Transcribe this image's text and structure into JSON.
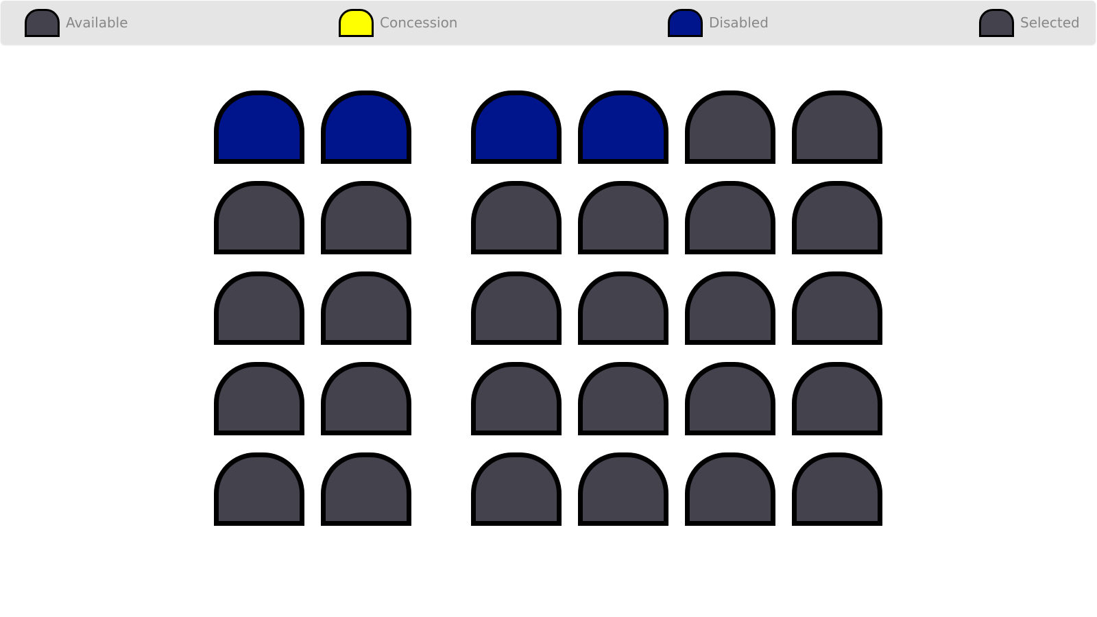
{
  "colors": {
    "available": "#43424d",
    "concession": "#ffff00",
    "disabled": "#00148c",
    "selected": "#43424d"
  },
  "legend": [
    {
      "key": "available",
      "label": "Available"
    },
    {
      "key": "concession",
      "label": "Concession"
    },
    {
      "key": "disabled",
      "label": "Disabled"
    },
    {
      "key": "selected",
      "label": "Selected"
    }
  ],
  "seat_map": {
    "blocks": [
      {
        "name": "left",
        "rows": [
          [
            "disabled",
            "disabled"
          ],
          [
            "available",
            "available"
          ],
          [
            "available",
            "available"
          ],
          [
            "available",
            "available"
          ],
          [
            "available",
            "available"
          ]
        ]
      },
      {
        "name": "right",
        "rows": [
          [
            "disabled",
            "disabled",
            "available",
            "available"
          ],
          [
            "available",
            "available",
            "available",
            "available"
          ],
          [
            "available",
            "available",
            "available",
            "available"
          ],
          [
            "available",
            "available",
            "available",
            "available"
          ],
          [
            "available",
            "available",
            "available",
            "available"
          ]
        ]
      }
    ]
  }
}
